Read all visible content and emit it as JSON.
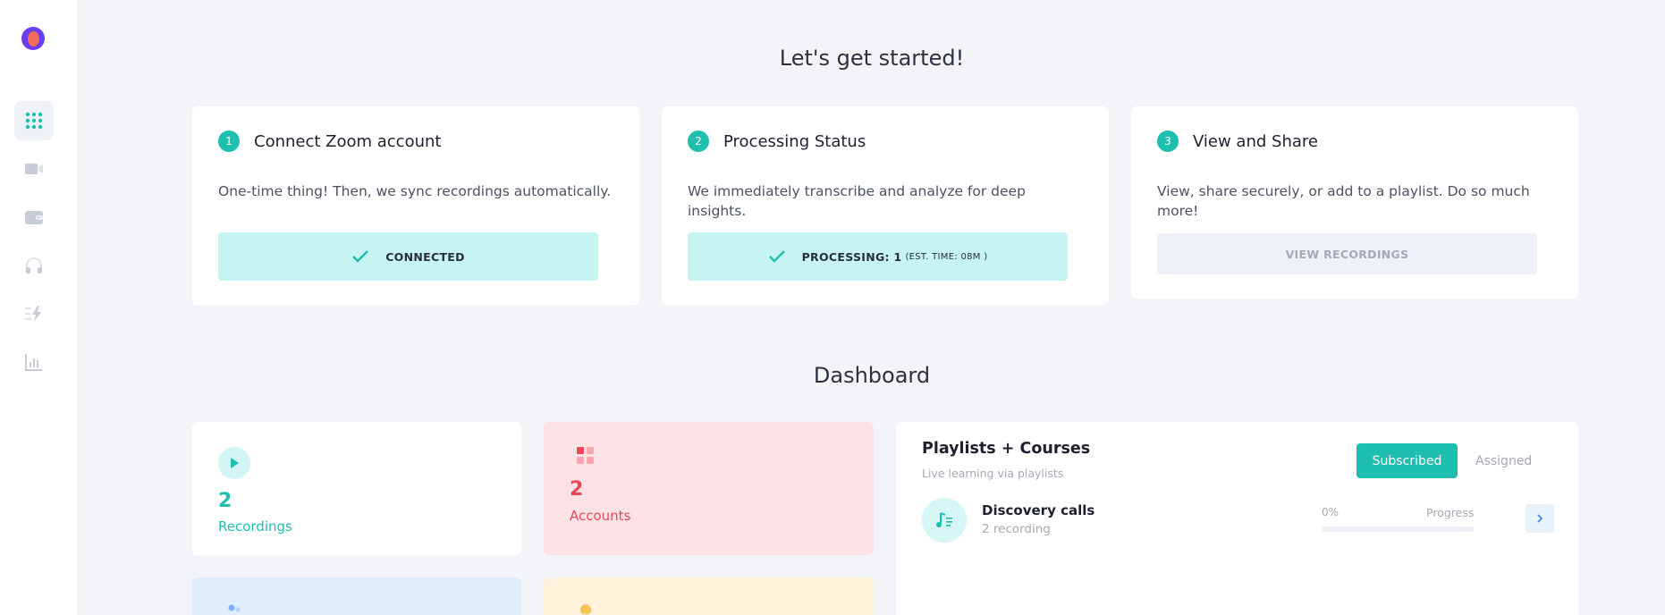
{
  "colors": {
    "accent": "#1fbfb0",
    "brand": "#6a3cf2",
    "danger": "#e8485a"
  },
  "sidebar": {
    "items": [
      {
        "icon": "grid-icon",
        "active": true
      },
      {
        "icon": "video-camera-icon",
        "active": false
      },
      {
        "icon": "wallet-icon",
        "active": false
      },
      {
        "icon": "headphones-icon",
        "active": false
      },
      {
        "icon": "lightning-list-icon",
        "active": false
      },
      {
        "icon": "bar-chart-icon",
        "active": false
      }
    ]
  },
  "getting_started": {
    "title": "Let's get started!",
    "steps": [
      {
        "number": "1",
        "title": "Connect Zoom account",
        "description": "One-time thing! Then, we sync recordings automatically.",
        "button": "CONNECTED"
      },
      {
        "number": "2",
        "title": "Processing Status",
        "description": "We immediately transcribe and analyze for deep insights.",
        "button": "PROCESSING: 1",
        "button_note": "(EST. TIME: 08M )"
      },
      {
        "number": "3",
        "title": "View and Share",
        "description": "View, share securely, or add to a playlist. Do so much more!",
        "button": "VIEW RECORDINGS"
      }
    ]
  },
  "dashboard": {
    "title": "Dashboard",
    "stats": [
      {
        "value": "2",
        "label": "Recordings",
        "icon": "play-icon",
        "color": "#1fbfb0"
      },
      {
        "value": "2",
        "label": "Accounts",
        "icon": "blocks-icon",
        "color": "#e8485a"
      }
    ],
    "playlists": {
      "title": "Playlists + Courses",
      "subtitle": "Live learning via playlists",
      "tabs": [
        "Subscribed",
        "Assigned"
      ],
      "items": [
        {
          "name": "Discovery calls",
          "count": "2 recording",
          "percent": "0%",
          "progress_label": "Progress",
          "progress": 0
        }
      ]
    }
  }
}
